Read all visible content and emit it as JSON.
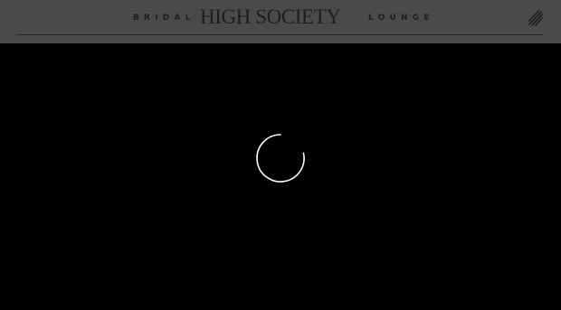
{
  "header": {
    "brand_left": "BRIDAL",
    "brand_main": "HIGH SOCIETY",
    "brand_right": "LOUNGE",
    "menu_icon": "hamburger-menu-icon"
  },
  "loader": {
    "icon": "loading-spinner-icon"
  },
  "colors": {
    "header_bg": "#4a4a4a",
    "brand_text": "#1e1e1e",
    "page_bg": "#000000",
    "spinner": "#ffffff"
  }
}
